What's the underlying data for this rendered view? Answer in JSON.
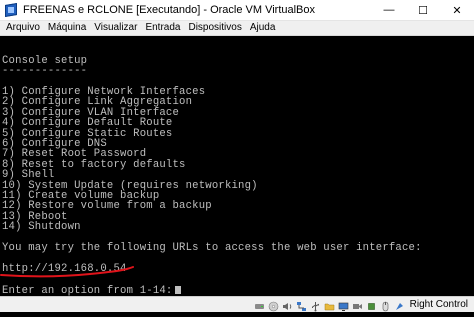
{
  "window": {
    "title": "FREENAS e RCLONE [Executando] - Oracle VM VirtualBox",
    "minimize_glyph": "—",
    "maximize_glyph": "☐",
    "close_glyph": "✕"
  },
  "menu": {
    "items": [
      "Arquivo",
      "Máquina",
      "Visualizar",
      "Entrada",
      "Dispositivos",
      "Ajuda"
    ]
  },
  "console": {
    "heading": "Console setup",
    "heading_rule": "-------------",
    "options": [
      "1) Configure Network Interfaces",
      "2) Configure Link Aggregation",
      "3) Configure VLAN Interface",
      "4) Configure Default Route",
      "5) Configure Static Routes",
      "6) Configure DNS",
      "7) Reset Root Password",
      "8) Reset to factory defaults",
      "9) Shell",
      "10) System Update (requires networking)",
      "11) Create volume backup",
      "12) Restore volume from a backup",
      "13) Reboot",
      "14) Shutdown"
    ],
    "url_intro": "You may try the following URLs to access the web user interface:",
    "url": "http://192.168.0.54",
    "prompt": "Enter an option from 1-14:",
    "annotation_color": "#e0131a"
  },
  "statusbar": {
    "host_key_label": "Right Control",
    "icons": [
      "hard-disk-icon",
      "optical-drive-icon",
      "audio-icon",
      "network-icon",
      "usb-icon",
      "shared-folder-icon",
      "display-icon",
      "recording-icon",
      "cpu-icon",
      "mouse-integration-icon",
      "keyboard-icon"
    ]
  }
}
